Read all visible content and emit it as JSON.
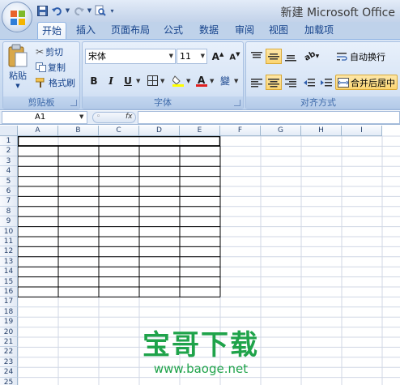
{
  "window": {
    "title": "新建 Microsoft Office"
  },
  "quick_access": {
    "icons": [
      "save-icon",
      "undo-icon",
      "redo-icon",
      "print-preview-icon",
      "customize-icon"
    ]
  },
  "tabs": [
    "开始",
    "插入",
    "页面布局",
    "公式",
    "数据",
    "审阅",
    "视图",
    "加载项"
  ],
  "active_tab": "开始",
  "ribbon": {
    "clipboard": {
      "label": "剪贴板",
      "paste": "粘贴",
      "cut": "剪切",
      "copy": "复制",
      "format_painter": "格式刷"
    },
    "font": {
      "label": "字体",
      "font_name": "宋体",
      "font_size": "11",
      "bold": "B",
      "italic": "I",
      "underline": "U",
      "phonetic": "變"
    },
    "alignment": {
      "label": "对齐方式",
      "wrap_text": "自动换行",
      "merge_center": "合并后居中"
    }
  },
  "formula_bar": {
    "name_box": "A1",
    "fx": "fx",
    "formula": ""
  },
  "columns": [
    "A",
    "B",
    "C",
    "D",
    "E",
    "F",
    "G",
    "H",
    "I"
  ],
  "rows": [
    "1",
    "2",
    "3",
    "4",
    "5",
    "6",
    "7",
    "8",
    "9",
    "10",
    "11",
    "12",
    "13",
    "14",
    "15",
    "16",
    "17",
    "18",
    "19",
    "20",
    "21",
    "22",
    "23",
    "24",
    "25"
  ],
  "watermark": {
    "title": "宝哥下载",
    "url": "www.baoge.net"
  },
  "colors": {
    "accent": "#15428b",
    "ribbon_bg": "#dbe6f5",
    "watermark": "#1fa34a",
    "selected_button": "#fbd572"
  }
}
